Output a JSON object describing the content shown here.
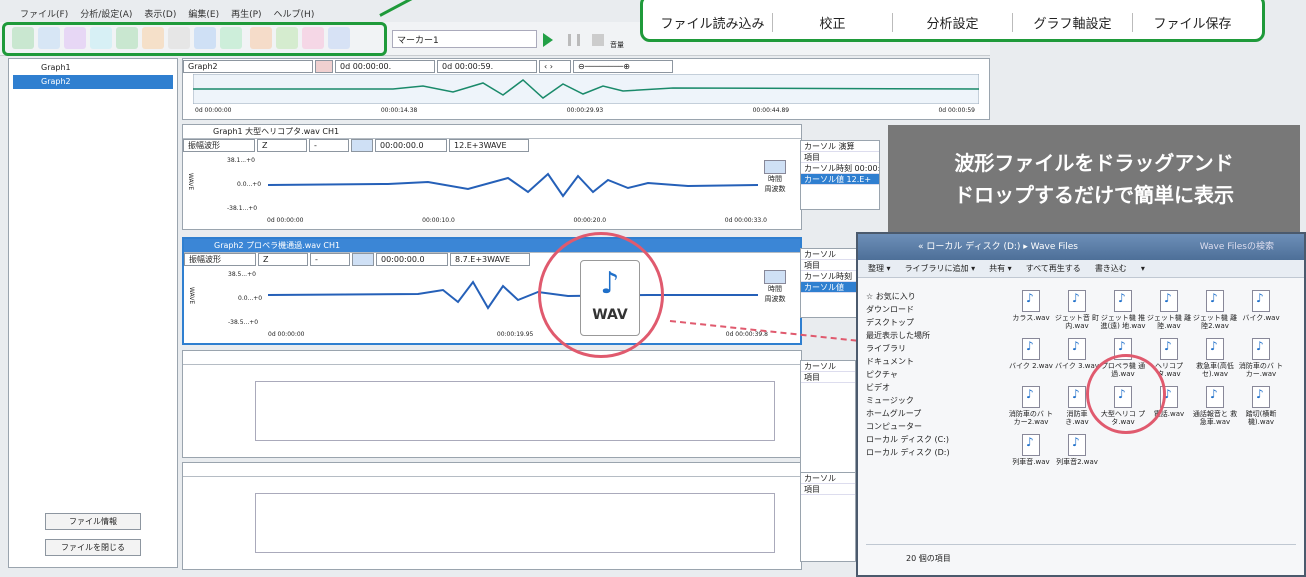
{
  "menu": [
    "ファイル(F)",
    "分析/設定(A)",
    "表示(D)",
    "編集(E)",
    "再生(P)",
    "ヘルプ(H)"
  ],
  "toolbar": {
    "marker": "マーカー1",
    "level_label": "音量"
  },
  "ribbon": [
    "ファイル読み込み",
    "校正",
    "分析設定",
    "グラフ軸設定",
    "ファイル保存"
  ],
  "left_panel": {
    "tree": [
      "Graph1",
      "Graph2"
    ],
    "buttons": [
      "ファイル情報",
      "ファイルを閉じる"
    ]
  },
  "top": {
    "graph_select": "Graph2",
    "t_start": "0d 00:00:00.",
    "t_end": "0d 00:00:59.",
    "axis": [
      "0d 00:00:00",
      "00:00:14.38",
      "00:00:29.93",
      "00:00:44.89",
      "0d 00:00:59"
    ]
  },
  "graph1": {
    "title": "Graph1  大型ヘリコプタ.wav  CH1",
    "mode": "振幅波形",
    "ch": "Z",
    "time": "00:00:00.0",
    "rate": "12.E+3WAVE",
    "ylabels": [
      "38.1...+0",
      "0.0...+0",
      "-38.1...+0"
    ],
    "xlabels": [
      "0d 00:00:00",
      "00:00:10.0",
      "00:00:20.0",
      "0d 00:00:33.0"
    ],
    "yaxis": "WAVE",
    "side": {
      "tab": "カーソル",
      "tab2": "演算",
      "rows": [
        "項目",
        "カーソル時刻",
        "カーソル値"
      ],
      "vals": [
        "00:00:",
        "12.E+"
      ]
    }
  },
  "graph2": {
    "title": "Graph2  プロペラ機通過.wav  CH1",
    "mode": "振幅波形",
    "ch": "Z",
    "time": "00:00:00.0",
    "rate": "8.7.E+3WAVE",
    "ylabels": [
      "38.5...+0",
      "0.0...+0",
      "-38.5...+0"
    ],
    "xlabels": [
      "0d 00:00:00",
      "00:00:19.95",
      "0d 00:00:39.8"
    ],
    "yaxis": "WAVE",
    "side": {
      "tab": "カーソル",
      "rows": [
        "項目",
        "カーソル時刻",
        "カーソル値"
      ]
    }
  },
  "graph3": {
    "side": {
      "tab": "カーソル",
      "rows": [
        "項目"
      ]
    }
  },
  "graph4": {
    "side": {
      "tab": "カーソル",
      "rows": [
        "項目"
      ]
    }
  },
  "side_buttons": {
    "time": "時間",
    "freq": "周波数"
  },
  "wav_label": "WAV",
  "callout": [
    "波形ファイルをドラッグアンド",
    "ドロップするだけで簡単に表示"
  ],
  "explorer": {
    "path": "« ローカル ディスク (D:) ▸ Wave Files",
    "search": "Wave Filesの検索",
    "tools": [
      "整理 ▾",
      "ライブラリに追加 ▾",
      "共有 ▾",
      "すべて再生する",
      "書き込む",
      "▾"
    ],
    "nav": [
      "☆ お気に入り",
      "ダウンロード",
      "デスクトップ",
      "最近表示した場所",
      "",
      "ライブラリ",
      "ドキュメント",
      "ピクチャ",
      "ビデオ",
      "ミュージック",
      "",
      "ホームグループ",
      "",
      "コンピューター",
      "ローカル ディスク (C:)",
      "ローカル ディスク (D:)"
    ],
    "files": [
      "カラス.wav",
      "ジェット音 町内.wav",
      "ジェット機 推進(遠) 地.wav",
      "ジェット機 離陸.wav",
      "ジェット機 離陸2.wav",
      "バイク.wav",
      "バイク 2.wav",
      "バイク 3.wav",
      "プロペラ機 通過.wav",
      "ヘリコプタ.wav",
      "救急車(高低セ).wav",
      "消防車のバ トカー.wav",
      "消防車のバ トカー2.wav",
      "消防車 き.wav",
      "大型ヘリコ プタ.wav",
      "電話.wav",
      "通話報音と 救急車.wav",
      "踏切(横断 機).wav",
      "列車音.wav",
      "列車音2.wav"
    ],
    "status": "20 個の項目"
  }
}
